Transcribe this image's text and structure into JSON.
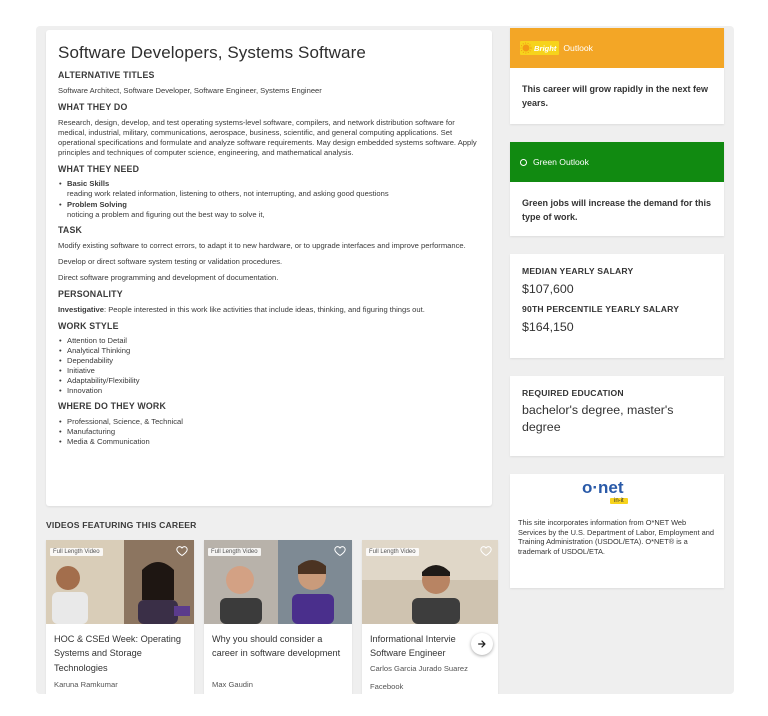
{
  "career": {
    "title": "Software Developers, Systems Software",
    "sections": {
      "alt_titles_heading": "ALTERNATIVE TITLES",
      "alt_titles": "Software Architect, Software Developer, Software Engineer, Systems Engineer",
      "what_they_do_heading": "WHAT THEY DO",
      "what_they_do": "Research, design, develop, and test operating systems-level software, compilers, and network distribution software for medical, industrial, military, communications, aerospace, business, scientific, and general computing applications. Set operational specifications and formulate and analyze software requirements. May design embedded systems software. Apply principles and techniques of computer science, engineering, and mathematical analysis.",
      "what_they_need_heading": "WHAT THEY NEED",
      "skills": [
        {
          "name": "Basic Skills",
          "desc": "reading work related information, listening to others, not interrupting, and asking good questions"
        },
        {
          "name": "Problem Solving",
          "desc": "noticing a problem and figuring out the best way to solve it,"
        }
      ],
      "task_heading": "TASK",
      "tasks": [
        "Modify existing software to correct errors, to adapt it to new hardware, or to upgrade interfaces and improve performance.",
        "Develop or direct software system testing or validation procedures.",
        "Direct software programming and development of documentation."
      ],
      "personality_heading": "PERSONALITY",
      "personality_label": "Investigative",
      "personality_text": ": People interested in this work like activities that include ideas, thinking, and figuring things out.",
      "work_style_heading": "WORK STYLE",
      "work_style": [
        "Attention to Detail",
        "Analytical Thinking",
        "Dependability",
        "Initiative",
        "Adaptability/Flexibility",
        "Innovation"
      ],
      "where_heading": "WHERE DO THEY WORK",
      "where": [
        "Professional, Science, & Technical",
        "Manufacturing",
        "Media & Communication"
      ]
    }
  },
  "videos": {
    "heading": "VIDEOS FEATURING THIS CAREER",
    "badge": "Full Length Video",
    "items": [
      {
        "title": "HOC & CSEd Week: Operating Systems and Storage Technologies",
        "person": "Karuna Ramkumar",
        "org": ""
      },
      {
        "title": "Why you should consider a career in software development",
        "person": "Max Gaudin",
        "org": ""
      },
      {
        "title": "Informational Intervie Software Engineer",
        "person": "Carlos Garcia Jurado Suarez",
        "org": "Facebook"
      }
    ]
  },
  "sidebar": {
    "bright": {
      "logo_text": "Bright",
      "label": "Outlook",
      "text": "This career will grow rapidly in the next few years.",
      "color": "#f3a626"
    },
    "green": {
      "label": "Green Outlook",
      "text": "Green jobs will increase the demand for this type of work.",
      "color": "#118a11"
    },
    "salary": {
      "median_label": "MEDIAN YEARLY SALARY",
      "median": "$107,600",
      "p90_label": "90TH PERCENTILE YEARLY SALARY",
      "p90": "$164,150"
    },
    "education": {
      "label": "REQUIRED EDUCATION",
      "value": "bachelor's degree, master's degree"
    },
    "onet": {
      "logo_main": "o·net",
      "logo_sub": "in-it",
      "text": "This site incorporates information from O*NET Web Services by the U.S. Department of Labor, Employment and Training Administration (USDOL/ETA). O*NET® is a trademark of USDOL/ETA."
    }
  },
  "icons": [
    "heart-icon",
    "arrow-right-icon",
    "bright-sun-icon",
    "circle-icon"
  ]
}
